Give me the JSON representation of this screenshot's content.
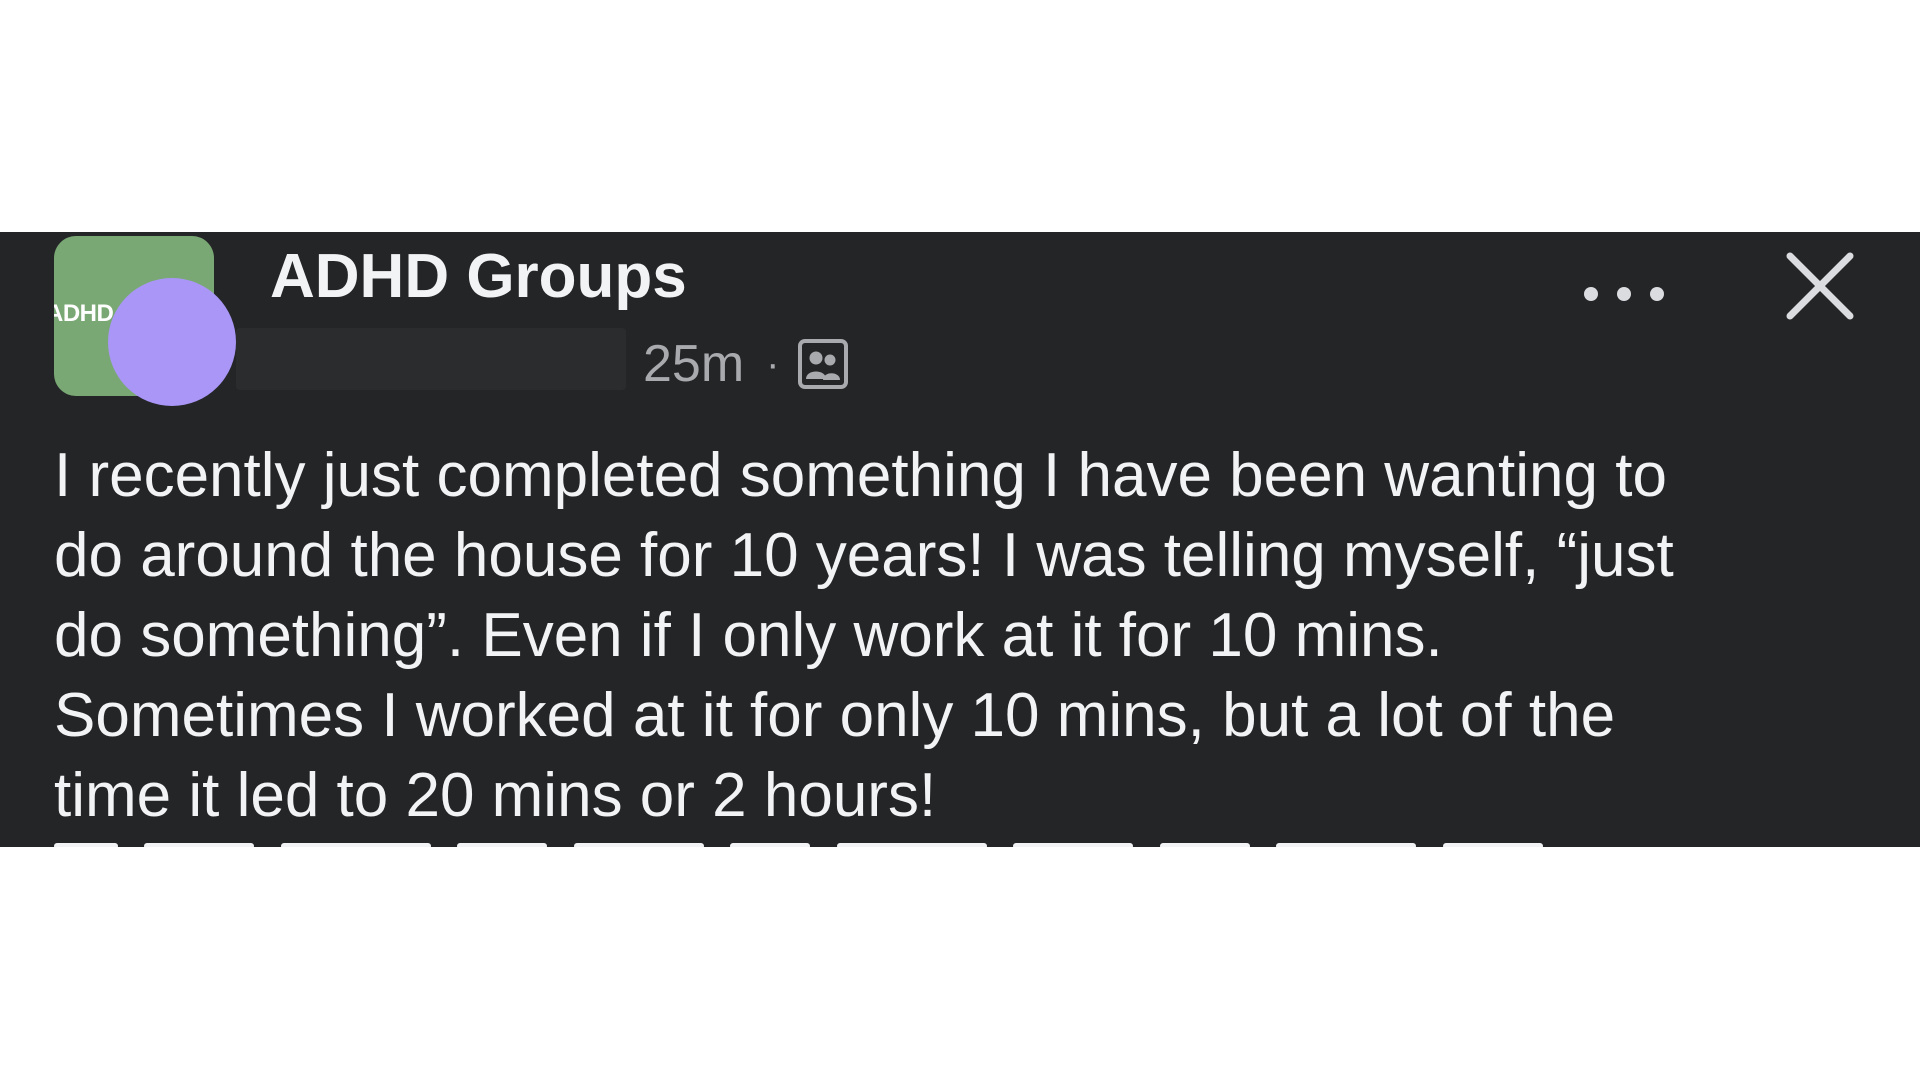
{
  "post": {
    "group_name": "ADHD Groups",
    "group_avatar_text": "ADHD",
    "timestamp": "25m",
    "separator": "·",
    "privacy_icon": "group-members-icon",
    "more_icon": "more-dots-icon",
    "close_icon": "close-icon",
    "body_lines": [
      "I recently just completed something I have been wanting to",
      "do around the house for 10 years! I was telling myself, “just",
      "do something”. Even if I only work at it for 10 mins.",
      "Sometimes I worked at it for only 10 mins, but a lot of the",
      "time it led to 20 mins or 2 hours!"
    ],
    "colors": {
      "background": "#242527",
      "text": "#f2f3f5",
      "meta_text": "#a8aaae",
      "group_avatar": "#7aa874",
      "user_avatar": "#a996f7"
    }
  }
}
